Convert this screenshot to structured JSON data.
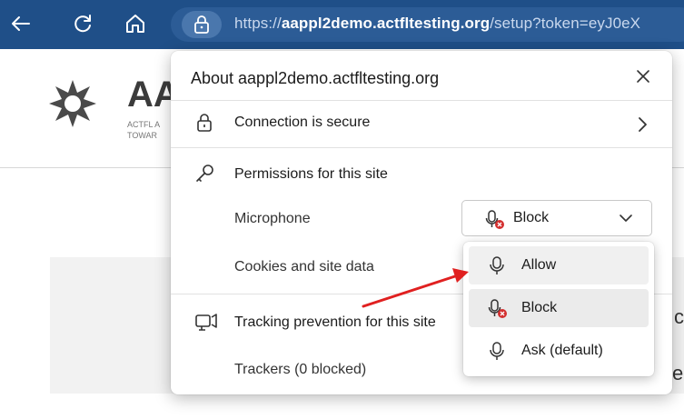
{
  "browser": {
    "url_prefix": "https://",
    "url_domain": "aappl2demo.actfltesting.org",
    "url_rest": "/setup?token=eyJ0eX"
  },
  "page": {
    "brand_text": "AA",
    "brand_line1": "ACTFL A",
    "brand_line2": "TOWAR",
    "side_letter_1": "c",
    "side_letter_2": "e"
  },
  "flyout": {
    "title": "About aappl2demo.actfltesting.org",
    "connection_label": "Connection is secure",
    "permissions_label": "Permissions for this site",
    "microphone_label": "Microphone",
    "microphone_value": "Block",
    "cookies_label": "Cookies and site data",
    "tracking_label": "Tracking prevention for this site",
    "trackers_label": "Trackers (0 blocked)"
  },
  "menu": {
    "items": [
      {
        "label": "Allow",
        "icon": "microphone-icon",
        "state": "hover"
      },
      {
        "label": "Block",
        "icon": "microphone-blocked-icon",
        "state": "selected"
      },
      {
        "label": "Ask (default)",
        "icon": "microphone-icon",
        "state": "normal"
      }
    ]
  },
  "colors": {
    "toolbar": "#1f4f88",
    "annotation_arrow": "#e02020",
    "block_badge": "#d32f2f"
  }
}
